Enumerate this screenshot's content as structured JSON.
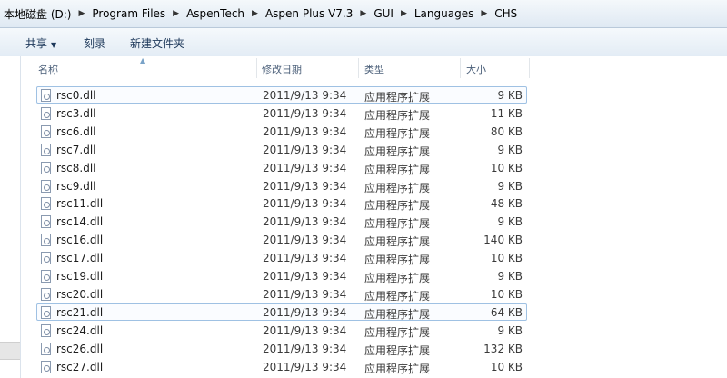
{
  "breadcrumb": [
    "本地磁盘 (D:)",
    "Program Files",
    "AspenTech",
    "Aspen Plus V7.3",
    "GUI",
    "Languages",
    "CHS"
  ],
  "toolbar": {
    "organize": "共享",
    "burn": "刻录",
    "new_folder": "新建文件夹"
  },
  "columns": {
    "name": "名称",
    "date": "修改日期",
    "type": "类型",
    "size": "大小"
  },
  "files": [
    {
      "name": "rsc0.dll",
      "date": "2011/9/13 9:34",
      "type": "应用程序扩展",
      "size": "9 KB",
      "selected": true
    },
    {
      "name": "rsc3.dll",
      "date": "2011/9/13 9:34",
      "type": "应用程序扩展",
      "size": "11 KB"
    },
    {
      "name": "rsc6.dll",
      "date": "2011/9/13 9:34",
      "type": "应用程序扩展",
      "size": "80 KB"
    },
    {
      "name": "rsc7.dll",
      "date": "2011/9/13 9:34",
      "type": "应用程序扩展",
      "size": "9 KB"
    },
    {
      "name": "rsc8.dll",
      "date": "2011/9/13 9:34",
      "type": "应用程序扩展",
      "size": "10 KB"
    },
    {
      "name": "rsc9.dll",
      "date": "2011/9/13 9:34",
      "type": "应用程序扩展",
      "size": "9 KB"
    },
    {
      "name": "rsc11.dll",
      "date": "2011/9/13 9:34",
      "type": "应用程序扩展",
      "size": "48 KB"
    },
    {
      "name": "rsc14.dll",
      "date": "2011/9/13 9:34",
      "type": "应用程序扩展",
      "size": "9 KB"
    },
    {
      "name": "rsc16.dll",
      "date": "2011/9/13 9:34",
      "type": "应用程序扩展",
      "size": "140 KB"
    },
    {
      "name": "rsc17.dll",
      "date": "2011/9/13 9:34",
      "type": "应用程序扩展",
      "size": "10 KB"
    },
    {
      "name": "rsc19.dll",
      "date": "2011/9/13 9:34",
      "type": "应用程序扩展",
      "size": "9 KB"
    },
    {
      "name": "rsc20.dll",
      "date": "2011/9/13 9:34",
      "type": "应用程序扩展",
      "size": "10 KB"
    },
    {
      "name": "rsc21.dll",
      "date": "2011/9/13 9:34",
      "type": "应用程序扩展",
      "size": "64 KB",
      "selected": true
    },
    {
      "name": "rsc24.dll",
      "date": "2011/9/13 9:34",
      "type": "应用程序扩展",
      "size": "9 KB"
    },
    {
      "name": "rsc26.dll",
      "date": "2011/9/13 9:34",
      "type": "应用程序扩展",
      "size": "132 KB"
    },
    {
      "name": "rsc27.dll",
      "date": "2011/9/13 9:34",
      "type": "应用程序扩展",
      "size": "10 KB"
    }
  ]
}
